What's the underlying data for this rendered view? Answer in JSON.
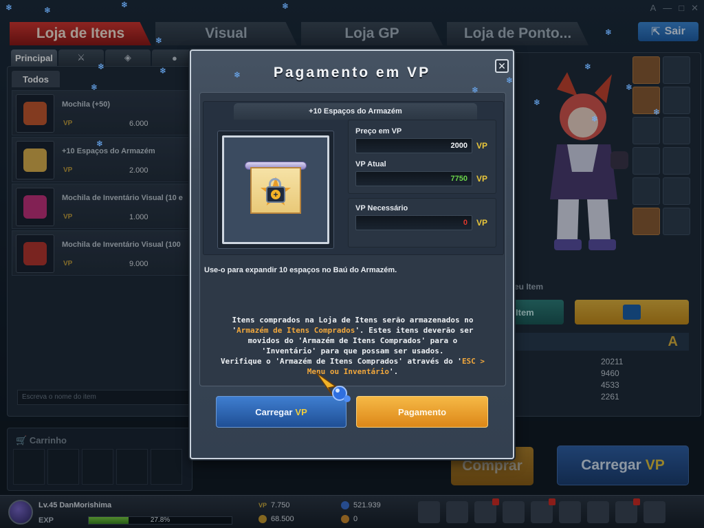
{
  "window": {
    "controls": [
      "A",
      "—",
      "□",
      "✕"
    ]
  },
  "top_tabs": [
    {
      "label": "Loja de Itens",
      "active": true
    },
    {
      "label": "Visual",
      "active": false
    },
    {
      "label": "Loja GP",
      "active": false
    },
    {
      "label": "Loja de Ponto...",
      "active": false
    }
  ],
  "exit_button": {
    "label": "Sair",
    "icon": "exit-icon"
  },
  "sub_tabs": [
    {
      "label": "Principal",
      "active": true
    },
    {
      "label": "",
      "icon": "crossed-swords-icon"
    },
    {
      "label": "",
      "icon": "gem-icon"
    },
    {
      "label": "",
      "icon": "bag-icon"
    }
  ],
  "filter_tab": "Todos",
  "items": [
    {
      "name": "Mochila (+50)",
      "currency": "VP",
      "price": "6.000",
      "thumb_color": "#c8562a"
    },
    {
      "name": "+10 Espaços do Armazém",
      "currency": "VP",
      "price": "2.000",
      "thumb_color": "#e0b24a"
    },
    {
      "name": "Mochila de Inventário Visual (10 e",
      "currency": "VP",
      "price": "1.000",
      "thumb_color": "#c72f7a"
    },
    {
      "name": "Mochila de Inventário Visual (100",
      "currency": "VP",
      "price": "9.000",
      "thumb_color": "#b8342a"
    }
  ],
  "search": {
    "placeholder": "Escreva o nome do item"
  },
  "cart": {
    "label": "Carrinho"
  },
  "right_panel": {
    "equip_label": "eu Item",
    "item_button": "Item",
    "stat_letter": "A",
    "stats": [
      "20211",
      "9460",
      "4533",
      "2261"
    ],
    "buy_button": "Comprar",
    "charge_button": {
      "label": "Carregar",
      "vp": "VP"
    }
  },
  "hud": {
    "level_name": "Lv.45 DanMorishima",
    "exp_label": "EXP",
    "exp_percent_text": "27.8%",
    "exp_fraction": 0.278,
    "vp_amount": "7.750",
    "gp_amount": "68.500",
    "points_amount": "521.939",
    "coins_amount": "0"
  },
  "modal": {
    "title": "Pagamento em VP",
    "close_label": "✕",
    "item_name": "+10 Espaços do Armazém",
    "price_label": "Preço em VP",
    "price_value": "2000",
    "current_label": "VP Atual",
    "current_value": "7750",
    "needed_label": "VP Necessário",
    "needed_value": "0",
    "unit": "VP",
    "description": "Use-o para expandir 10 espaços no Baú do Armazém.",
    "notice": {
      "l1": "Itens comprados na Loja de Itens serão armazenados no",
      "l2a": "'",
      "l2b": "Armazém de Itens Comprados",
      "l2c": "'. Estes itens deverão ser",
      "l3": "movidos do 'Armazém de Itens Comprados' para o",
      "l4": "'Inventário' para que possam ser usados.",
      "l5a": "Verifique o 'Armazém de Itens Comprados' através do '",
      "l5b": "ESC >",
      "l6a": "Menu ou Inventário",
      "l6b": "'."
    },
    "charge_button": {
      "label": "Carregar",
      "vp": "VP"
    },
    "pay_button": "Pagamento"
  },
  "colors": {
    "accent_red": "#c52a22",
    "vp_gold": "#e9c63a",
    "current_green": "#6bd64a",
    "needed_red": "#e0382e",
    "highlight_orange": "#f2a83c"
  }
}
